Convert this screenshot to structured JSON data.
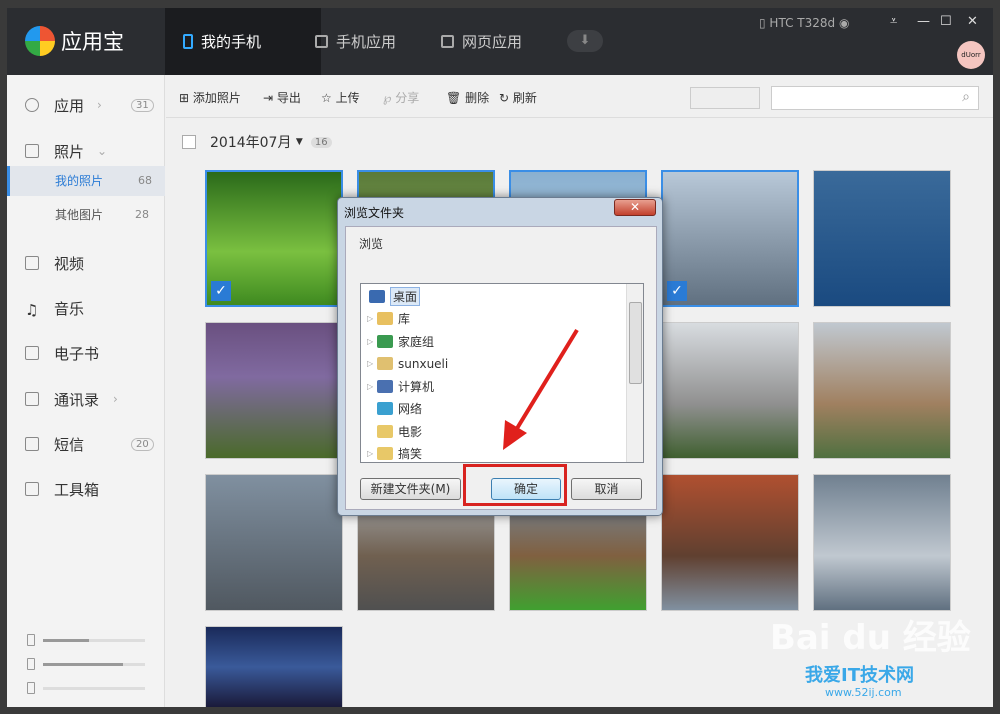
{
  "app": {
    "name": "应用宝",
    "device": "HTC T328d",
    "avatar_text": "dUorr"
  },
  "tabs": [
    {
      "label": "我的手机"
    },
    {
      "label": "手机应用"
    },
    {
      "label": "网页应用"
    }
  ],
  "sidebar": {
    "items": [
      {
        "label": "应用",
        "count": "31"
      },
      {
        "label": "照片"
      },
      {
        "label": "视频"
      },
      {
        "label": "音乐"
      },
      {
        "label": "电子书"
      },
      {
        "label": "通讯录"
      },
      {
        "label": "短信",
        "count": "20"
      },
      {
        "label": "工具箱"
      }
    ],
    "subitems": [
      {
        "label": "我的照片",
        "count": "68"
      },
      {
        "label": "其他图片",
        "count": "28"
      }
    ],
    "storage": [
      {
        "name": "phone",
        "fill": 0.45
      },
      {
        "name": "sd1",
        "fill": 0.78
      },
      {
        "name": "sd2",
        "fill": 0.0
      }
    ]
  },
  "toolbar": {
    "add": "添加照片",
    "export": "导出",
    "upload": "上传",
    "share": "分享",
    "delete": "删除",
    "refresh": "刷新"
  },
  "group": {
    "title": "2014年07月",
    "count": "16"
  },
  "dialog": {
    "title": "浏览文件夹",
    "label": "浏览",
    "tree": [
      {
        "name": "桌面"
      },
      {
        "name": "库"
      },
      {
        "name": "家庭组"
      },
      {
        "name": "sunxueli"
      },
      {
        "name": "计算机"
      },
      {
        "name": "网络"
      },
      {
        "name": "电影"
      },
      {
        "name": "搞笑"
      }
    ],
    "new_folder": "新建文件夹(M)",
    "ok": "确定",
    "cancel": "取消"
  },
  "watermark": {
    "text1": "Bai du 经验",
    "text2": "我爱IT技术网",
    "url": "www.52ij.com"
  }
}
